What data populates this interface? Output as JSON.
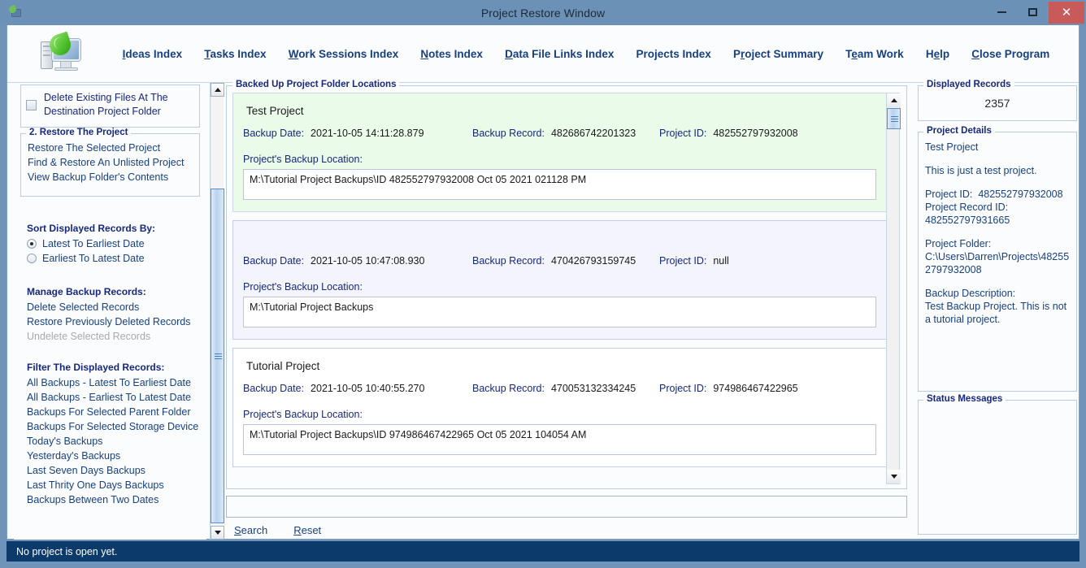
{
  "window": {
    "title": "Project Restore Window",
    "minimize_label": "–",
    "maximize_label": "□",
    "close_label": "✕",
    "accent_titlebar": "#6b91b7",
    "accent_close": "#c85a5a",
    "accent_statusbar": "#0b3a6b"
  },
  "menu": {
    "items": [
      {
        "pre": "",
        "key": "I",
        "post": "deas Index"
      },
      {
        "pre": "",
        "key": "T",
        "post": "asks Index"
      },
      {
        "pre": "",
        "key": "W",
        "post": "ork Sessions Index"
      },
      {
        "pre": "",
        "key": "N",
        "post": "otes Index"
      },
      {
        "pre": "",
        "key": "D",
        "post": "ata File Links Index"
      },
      {
        "pre": "Projects Index",
        "key": "",
        "post": ""
      },
      {
        "pre": "P",
        "key": "r",
        "post": "oject Summary"
      },
      {
        "pre": "T",
        "key": "e",
        "post": "am Work"
      },
      {
        "pre": "H",
        "key": "e",
        "post": "lp"
      },
      {
        "pre": "",
        "key": "C",
        "post": "lose Program"
      }
    ]
  },
  "sidebar": {
    "checkbox": {
      "label": "Delete Existing Files At The Destination Project Folder",
      "checked": false
    },
    "restore_group": {
      "legend": "2. Restore The Project",
      "links": [
        "Restore The Selected Project",
        "Find & Restore An Unlisted Project",
        "View Backup Folder's Contents"
      ]
    },
    "sort_heading": "Sort Displayed Records By:",
    "sort_options": [
      {
        "label": "Latest To Earliest Date",
        "selected": true
      },
      {
        "label": "Earliest To Latest Date",
        "selected": false
      }
    ],
    "manage_heading": "Manage Backup Records:",
    "manage_links": [
      {
        "label": "Delete Selected Records",
        "disabled": false
      },
      {
        "label": "Restore Previously Deleted Records",
        "disabled": false
      },
      {
        "label": "Undelete Selected Records",
        "disabled": true
      }
    ],
    "filter_heading": "Filter The Displayed Records:",
    "filter_links": [
      "All Backups - Latest To Earliest Date",
      "All Backups - Earliest To Latest Date",
      "Backups For Selected Parent Folder",
      "Backups For Selected Storage Device",
      "Today's Backups",
      "Yesterday's Backups",
      "Last Seven Days Backups",
      "Last Thrity One Days Backups",
      "Backups Between Two Dates"
    ]
  },
  "center": {
    "legend": "Backed Up Project Folder Locations",
    "labels": {
      "backup_date": "Backup Date:",
      "backup_record": "Backup Record:",
      "project_id": "Project ID:",
      "location": "Project's Backup Location:"
    },
    "records": [
      {
        "title": "Test Project",
        "backup_date": "2021-10-05   14:11:28.879",
        "backup_record": "482686742201323",
        "project_id": "482552797932008",
        "location": "M:\\Tutorial Project Backups\\ID 482552797932008 Oct 05 2021 021128 PM",
        "state": "selected"
      },
      {
        "title": "",
        "backup_date": "2021-10-05   10:47:08.930",
        "backup_record": "470426793159745",
        "project_id": "null",
        "location": "M:\\Tutorial Project Backups",
        "state": "alt"
      },
      {
        "title": "Tutorial Project",
        "backup_date": "2021-10-05   10:40:55.270",
        "backup_record": "470053132334245",
        "project_id": "974986467422965",
        "location": "M:\\Tutorial Project Backups\\ID 974986467422965 Oct 05 2021 104054 AM",
        "state": "normal"
      }
    ],
    "search_value": "",
    "search_placeholder": "",
    "actions": [
      {
        "key": "S",
        "rest": "earch"
      },
      {
        "key": "R",
        "rest": "eset"
      }
    ]
  },
  "right": {
    "records_legend": "Displayed Records",
    "records_count": "2357",
    "details_legend": "Project Details",
    "details": {
      "project_name": "Test Project",
      "description": "This is just a test project.",
      "project_id_label": "Project ID:",
      "project_id": "482552797932008",
      "project_record_id_label": "Project Record ID:",
      "project_record_id": "482552797931665",
      "project_folder_label": "Project Folder:",
      "project_folder_line1": "C:\\Users\\Darren\\Projects\\48255",
      "project_folder_line2": "2797932008",
      "backup_desc_label": "Backup Description:",
      "backup_desc_line1": "Test Backup Project. This is not",
      "backup_desc_line2": "a tutorial project."
    },
    "status_legend": "Status Messages",
    "status_body": ""
  },
  "statusbar": {
    "message": "No project is open yet."
  },
  "icons": {
    "app": "computer-leaf-icon",
    "scroll_up": "triangle-up-icon",
    "scroll_down": "triangle-down-icon"
  }
}
